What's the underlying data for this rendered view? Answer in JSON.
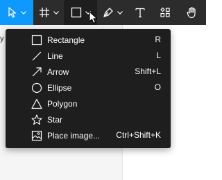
{
  "left_panel": {
    "label": "y"
  },
  "toolbar": {
    "tools": [
      {
        "name": "move",
        "icon": "move-cursor-icon",
        "active": true,
        "has_dropdown": true
      },
      {
        "name": "frame",
        "icon": "frame-hash-icon",
        "active": false,
        "has_dropdown": true
      },
      {
        "name": "shape",
        "icon": "rectangle-icon",
        "active": false,
        "open": true,
        "has_dropdown": true
      },
      {
        "name": "pen",
        "icon": "pen-icon",
        "active": false,
        "has_dropdown": true
      },
      {
        "name": "text",
        "icon": "text-icon",
        "active": false,
        "has_dropdown": false
      },
      {
        "name": "resources",
        "icon": "resources-icon",
        "active": false,
        "has_dropdown": false
      },
      {
        "name": "hand",
        "icon": "hand-icon",
        "active": false,
        "has_dropdown": false
      }
    ]
  },
  "shape_menu": {
    "items": [
      {
        "label": "Rectangle",
        "shortcut": "R",
        "icon": "rectangle-icon"
      },
      {
        "label": "Line",
        "shortcut": "L",
        "icon": "line-icon"
      },
      {
        "label": "Arrow",
        "shortcut": "Shift+L",
        "icon": "arrow-icon"
      },
      {
        "label": "Ellipse",
        "shortcut": "O",
        "icon": "ellipse-icon"
      },
      {
        "label": "Polygon",
        "shortcut": "",
        "icon": "polygon-icon"
      },
      {
        "label": "Star",
        "shortcut": "",
        "icon": "star-icon"
      },
      {
        "label": "Place image...",
        "shortcut": "Ctrl+Shift+K",
        "icon": "image-icon"
      }
    ]
  },
  "colors": {
    "toolbar_bg": "#2c2c2c",
    "active_tool": "#0d99ff",
    "open_tool": "#1e1e1e",
    "menu_bg": "#1e1e1e",
    "menu_text": "#ffffff",
    "canvas_bg": "#ffffff",
    "panel_bg": "#f5f5f5"
  }
}
